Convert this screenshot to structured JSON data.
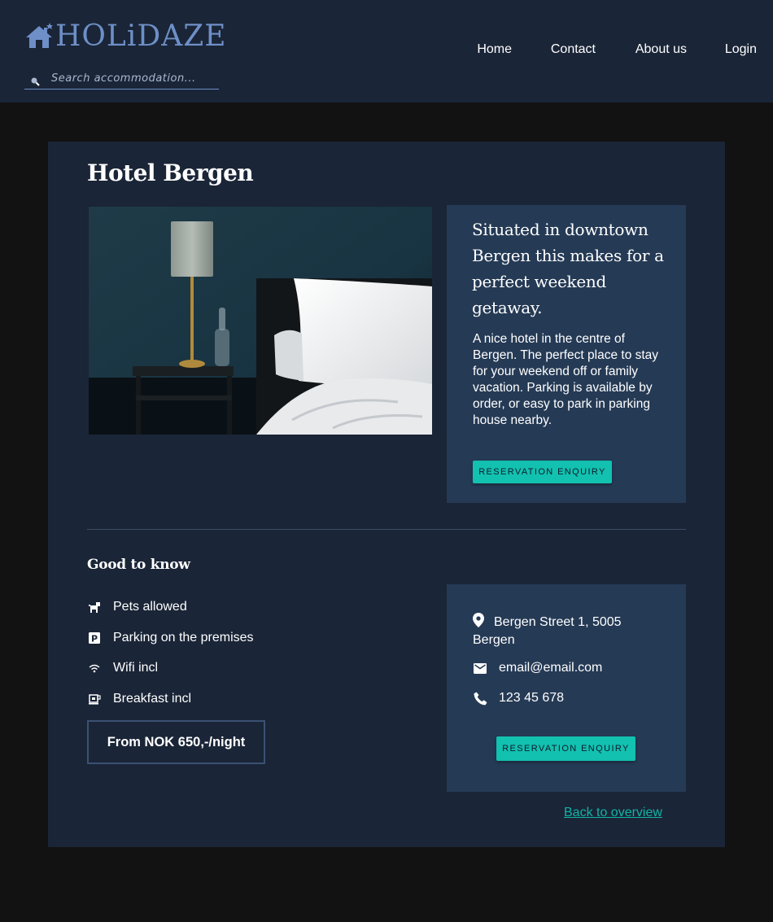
{
  "header": {
    "logo_text": "HOLiDAZE",
    "search": {
      "placeholder": "Search accommodation..."
    },
    "nav": [
      {
        "label": "Home"
      },
      {
        "label": "Contact"
      },
      {
        "label": "About us"
      },
      {
        "label": "Login"
      }
    ]
  },
  "hotel": {
    "title": "Hotel Bergen",
    "photo_icon": "bedroom-photo",
    "tagline": "Situated in downtown Bergen this makes for a perfect weekend getaway.",
    "description": "A nice hotel in the centre of Bergen. The perfect place to stay for your weekend off or family vacation. Parking is available by order, or easy to park in parking house nearby.",
    "reservation_label": "RESERVATION ENQUIRY"
  },
  "good_to_know": {
    "title": "Good to know",
    "amenities": [
      {
        "icon": "dog-icon",
        "label": "Pets allowed"
      },
      {
        "icon": "parking-icon",
        "label": "Parking on the premises"
      },
      {
        "icon": "wifi-icon",
        "label": "Wifi incl"
      },
      {
        "icon": "coffee-icon",
        "label": "Breakfast incl"
      }
    ],
    "price": "From NOK 650,-/night"
  },
  "contact": {
    "address": "Bergen Street 1, 5005 Bergen",
    "email": "email@email.com",
    "phone": "123 45 678",
    "reservation_label": "RESERVATION ENQUIRY"
  },
  "back_link": "Back to overview",
  "colors": {
    "header_bg": "#1a2537",
    "page_bg": "#121212",
    "panel_bg": "#253a55",
    "accent": "#12c1b0",
    "logo": "#6e8fc7"
  }
}
